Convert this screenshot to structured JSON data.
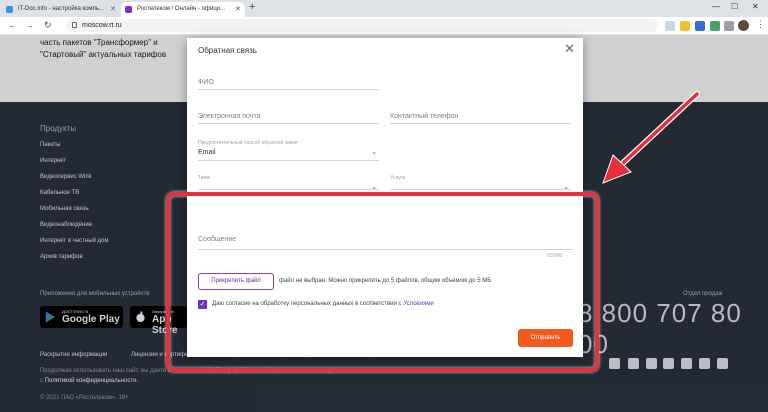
{
  "browser": {
    "tabs": [
      {
        "title": "IT-Doc.info - настройка компь..."
      },
      {
        "title": "Ростелеком / Онлайн - офици..."
      }
    ],
    "new_tab_symbol": "+",
    "address": "moscow.rt.ru"
  },
  "page": {
    "promo_text": "часть пакетов \"Трансформер\" и \"Стартовый\" актуальных тарифов",
    "products_heading": "Продукты",
    "products": [
      "Пакеты",
      "Интернет",
      "Видеосервис Wink",
      "Кабельное ТВ",
      "Мобильная связь",
      "Видеонаблюдение",
      "Интернет в частный дом",
      "Архив тарифов"
    ],
    "apps_title": "Приложения для мобильных устройств",
    "google_play": {
      "small": "ДОСТУПНО В",
      "big": "Google Play"
    },
    "app_store": {
      "small": "Загрузите в",
      "big": "App Store"
    },
    "sales_label": "Отдел продаж",
    "phone": "8 800 707 80 00",
    "bottom_links": [
      "Раскрытие информации",
      "Лицензии и сертификаты",
      "Закупки",
      "Сообщить о нарушении этического кодекса"
    ],
    "fine_print": "Продолжая использовать наш сайт, вы даете согласие на обработку файлов cookie, пользовательских данных...",
    "policy_prefix": "с",
    "policy_link": "Политикой конфиденциальности.",
    "copyright": "© 2021 ПАО «Ростелеком». 18+"
  },
  "modal": {
    "title": "Обратная связь",
    "close": "✕",
    "fio": "ФИО",
    "email": "Электронная почта",
    "phone": "Контактный телефон",
    "contact_method_label": "Предпочтительный способ обратной связи",
    "contact_method_value": "Email",
    "topic": "Тема",
    "service": "Услуга",
    "message": "Сообщение",
    "counter": "0/2000",
    "attach_button": "Прикрепить файл",
    "attach_note": "файл не выбран. Можно прикрепить до 5 файлов, общим объемом до 5 МБ",
    "consent_text": "Даю согласие на обработку персональных данных в соответствии с",
    "consent_link": "Условиями",
    "submit": "Отправить"
  },
  "colors": {
    "accent": "#6a35c4",
    "submit": "#f25a1d",
    "annotation": "#e8303c",
    "footer_bg": "#2b3440"
  }
}
